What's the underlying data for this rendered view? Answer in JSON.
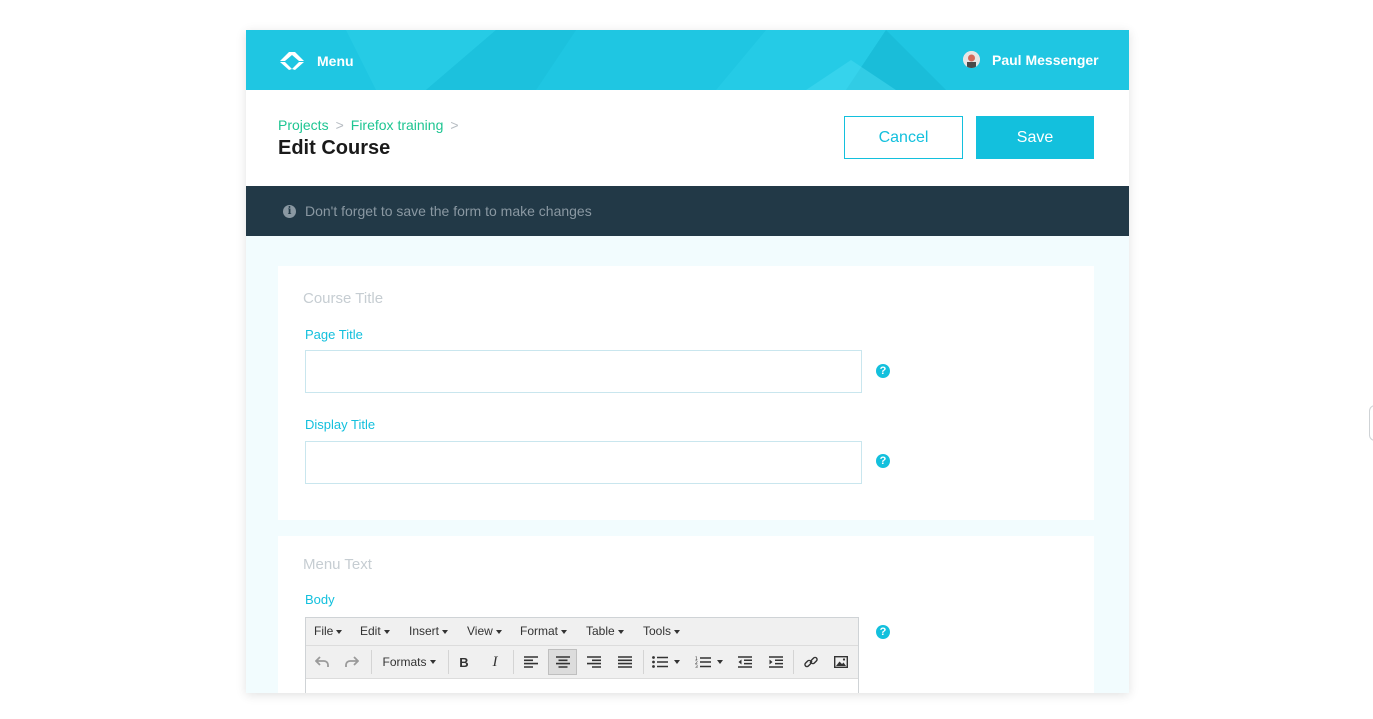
{
  "topbar": {
    "menu_label": "Menu",
    "user_name": "Paul Messenger",
    "accent_color": "#1fc6e2",
    "logo_icon": "diamond-logo-icon"
  },
  "header": {
    "breadcrumbs": [
      "Projects",
      "Firefox training"
    ],
    "breadcrumb_separator": ">",
    "title": "Edit Course",
    "cancel_label": "Cancel",
    "save_label": "Save"
  },
  "notice": {
    "icon": "info-icon",
    "text": "Don't forget to save the form to make changes"
  },
  "course_title_section": {
    "title": "Course Title",
    "page_title": {
      "label": "Page Title",
      "value": "",
      "placeholder": ""
    },
    "display_title": {
      "label": "Display Title",
      "value": "",
      "placeholder": ""
    }
  },
  "menu_text_section": {
    "title": "Menu Text",
    "body_label": "Body",
    "editor": {
      "menu": [
        "File",
        "Edit",
        "Insert",
        "View",
        "Format",
        "Table",
        "Tools"
      ],
      "formats_label": "Formats",
      "active_tool": "align-center"
    }
  },
  "colors": {
    "primary": "#13c0dd",
    "breadcrumb": "#1ec592",
    "notice_bg": "#223947",
    "content_bg": "#f2fcfe"
  }
}
